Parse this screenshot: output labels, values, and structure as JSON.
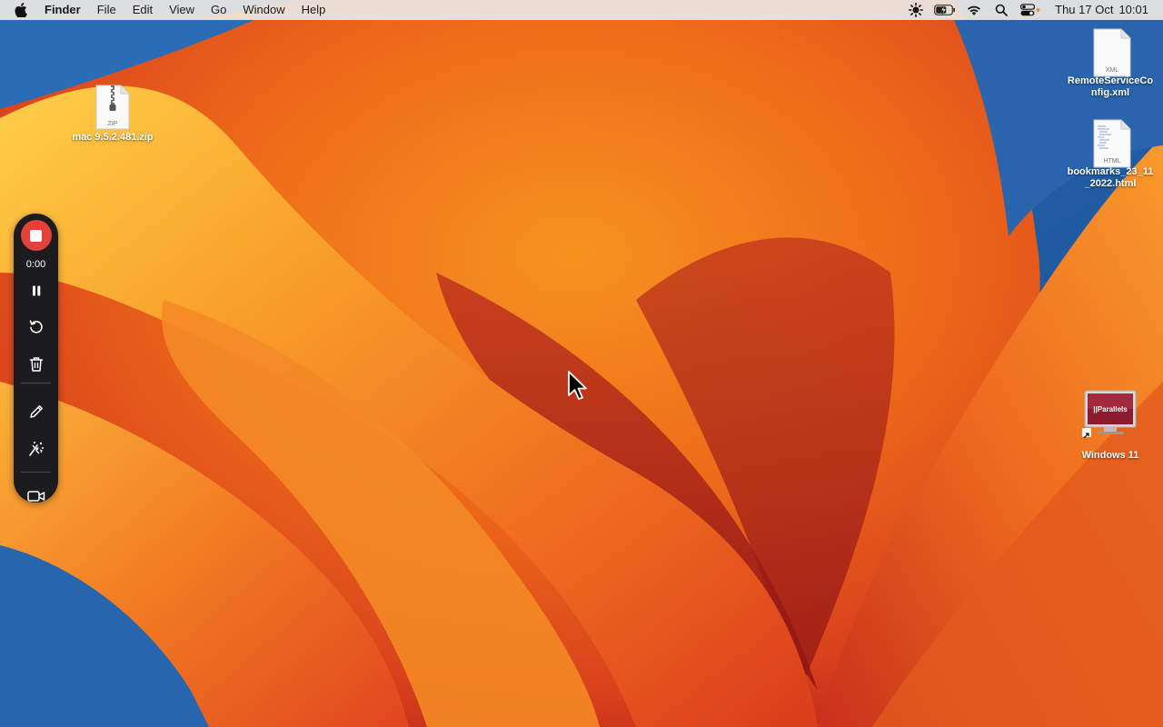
{
  "menubar": {
    "apple_icon": "apple-logo-icon",
    "app_name": "Finder",
    "menus": [
      "File",
      "Edit",
      "View",
      "Go",
      "Window",
      "Help"
    ],
    "status_icons": [
      "brightness-icon",
      "battery-icon",
      "wifi-icon",
      "spotlight-search-icon",
      "control-center-icon"
    ],
    "clock": {
      "date": "Thu 17 Oct",
      "time": "10:01"
    }
  },
  "desktop": {
    "icons": [
      {
        "label": "mac 9.5.2.481.zip",
        "type": "ZIP"
      },
      {
        "label": "RemoteServiceConfig.xml",
        "type": "XML"
      },
      {
        "label": "bookmarks_23_11_2022.html",
        "type": "HTML"
      },
      {
        "label": "Windows 11",
        "badge": "||Parallels"
      }
    ]
  },
  "recorder": {
    "elapsed": "0:00",
    "buttons": [
      "stop",
      "pause",
      "restart",
      "delete",
      "draw",
      "effects",
      "camera"
    ]
  },
  "colors": {
    "record_red": "#e5413a",
    "toolbar_bg": "#1c1c1e",
    "menubar_bg": "#ece8e4"
  }
}
